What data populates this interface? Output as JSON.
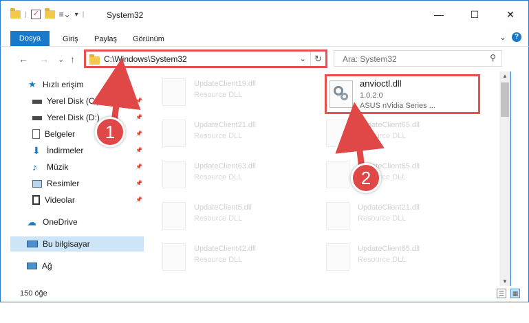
{
  "window": {
    "title": "System32",
    "controls": {
      "minimize": "—",
      "maximize": "☐",
      "close": "✕"
    }
  },
  "ribbon": {
    "tabs": [
      {
        "label": "Dosya"
      },
      {
        "label": "Giriş"
      },
      {
        "label": "Paylaş"
      },
      {
        "label": "Görünüm"
      }
    ],
    "collapse": "⌄",
    "help": "?"
  },
  "nav": {
    "back": "←",
    "forward": "→",
    "recent": "⌄",
    "up": "↑"
  },
  "address": {
    "path": "C:\\Windows\\System32",
    "dropdown": "⌄",
    "refresh": "↻"
  },
  "search": {
    "placeholder": "Ara: System32",
    "icon": "⚲"
  },
  "sidebar": {
    "items": [
      {
        "label": "Hızlı erişim",
        "pinned": false
      },
      {
        "label": "Yerel Disk (C:)",
        "pinned": true
      },
      {
        "label": "Yerel Disk (D:)",
        "pinned": true
      },
      {
        "label": "Belgeler",
        "pinned": true
      },
      {
        "label": "İndirmeler",
        "pinned": true
      },
      {
        "label": "Müzik",
        "pinned": true
      },
      {
        "label": "Resimler",
        "pinned": true
      },
      {
        "label": "Videolar",
        "pinned": true
      },
      {
        "label": "OneDrive",
        "pinned": false
      },
      {
        "label": "Bu bilgisayar",
        "pinned": false
      },
      {
        "label": "Ağ",
        "pinned": false
      }
    ],
    "pin_glyph": "📌"
  },
  "files": {
    "left_column": [
      {
        "name": "UpdateClient19.dll",
        "type": "Resource DLL"
      },
      {
        "name": "UpdateClient21.dll",
        "type": "Resource DLL"
      },
      {
        "name": "UpdateClient63.dll",
        "type": "Resource DLL"
      },
      {
        "name": "UpdateClient5.dll",
        "type": "Resource DLL"
      },
      {
        "name": "UpdateClient42.dll",
        "type": "Resource DLL"
      }
    ],
    "right_column": [
      {
        "name": "UpdateClient65.dll",
        "type": "Resource DLL"
      },
      {
        "name": "UpdateClient65.dll",
        "type": "Resource DLL"
      },
      {
        "name": "UpdateClient21.dll",
        "type": "Resource DLL"
      },
      {
        "name": "UpdateClient65.dll",
        "type": "Resource DLL"
      }
    ],
    "highlighted": {
      "name": "anvioctl.dll",
      "version": "1.0.2.0",
      "description": "ASUS nVidia Series ..."
    }
  },
  "scrollbar": {
    "up": "▲",
    "down": "▼"
  },
  "status": {
    "item_count": "150 öğe"
  },
  "annotations": {
    "step1": "1",
    "step2": "2",
    "color": "#e04848"
  }
}
